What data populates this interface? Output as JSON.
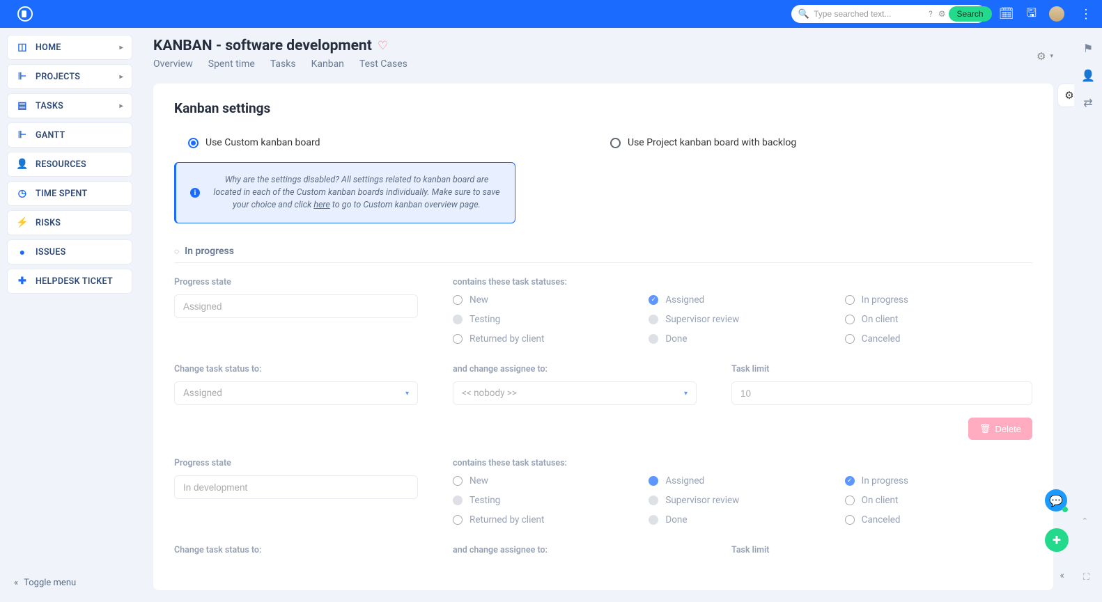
{
  "search": {
    "placeholder": "Type searched text...",
    "button": "Search"
  },
  "nav": [
    {
      "icon": "◫",
      "label": "HOME",
      "chevron": true
    },
    {
      "icon": "⊩",
      "label": "PROJECTS",
      "chevron": true
    },
    {
      "icon": "▤",
      "label": "TASKS",
      "chevron": true
    },
    {
      "icon": "⊩",
      "label": "GANTT",
      "chevron": false
    },
    {
      "icon": "👤",
      "label": "RESOURCES",
      "chevron": false
    },
    {
      "icon": "◷",
      "label": "TIME SPENT",
      "chevron": false
    },
    {
      "icon": "⚡",
      "label": "RISKS",
      "chevron": false
    },
    {
      "icon": "●",
      "label": "ISSUES",
      "chevron": false
    },
    {
      "icon": "✚",
      "label": "HELPDESK TICKET",
      "chevron": false
    }
  ],
  "toggle_menu": "Toggle menu",
  "page": {
    "title": "KANBAN - software development",
    "tabs": [
      "Overview",
      "Spent time",
      "Tasks",
      "Kanban",
      "Test Cases"
    ]
  },
  "panel": {
    "title": "Kanban settings",
    "option_custom": "Use Custom kanban board",
    "option_backlog": "Use Project kanban board with backlog",
    "info": {
      "prefix": "Why are the settings disabled? All settings related to kanban board are located in each of the Custom kanban boards individually. Make sure to save your choice and click ",
      "link": "here",
      "suffix": " to go to Custom kanban overview page."
    },
    "section": "In progress"
  },
  "labels": {
    "progress_state": "Progress state",
    "contains": "contains these task statuses:",
    "change_status": "Change task status to:",
    "change_assignee": "and change assignee to:",
    "task_limit": "Task limit"
  },
  "statuses": [
    "New",
    "Assigned",
    "In progress",
    "Testing",
    "Supervisor review",
    "On client",
    "Returned by client",
    "Done",
    "Canceled"
  ],
  "block1": {
    "progress_state": "Assigned",
    "checked_index": 1,
    "change_status": "Assigned",
    "change_assignee": "<< nobody >>",
    "task_limit": "10",
    "delete": "Delete"
  },
  "block2": {
    "progress_state": "In development",
    "checked_index": 2
  }
}
